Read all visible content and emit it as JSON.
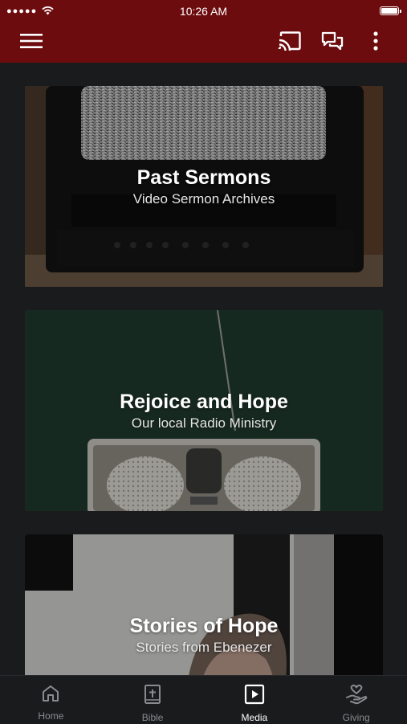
{
  "status_bar": {
    "signal": "●●●●●",
    "time": "10:26 AM"
  },
  "app_bar": {
    "icons": [
      "menu-icon",
      "cast-icon",
      "chat-icon",
      "more-vert-icon"
    ],
    "color": "#6d0c0e"
  },
  "cards": [
    {
      "title": "Past Sermons",
      "subtitle": "Video Sermon Archives"
    },
    {
      "title": "Rejoice and Hope",
      "subtitle": "Our local Radio Ministry"
    },
    {
      "title": "Stories of Hope",
      "subtitle": "Stories from Ebenezer"
    }
  ],
  "tabs": [
    {
      "label": "Home",
      "icon": "home-icon",
      "active": false
    },
    {
      "label": "Bible",
      "icon": "bible-icon",
      "active": false
    },
    {
      "label": "Media",
      "icon": "media-icon",
      "active": true
    },
    {
      "label": "Giving",
      "icon": "giving-icon",
      "active": false
    }
  ],
  "colors": {
    "brand": "#6d0c0e",
    "background": "#1a1b1d",
    "tab_inactive": "#8a8b8e",
    "tab_active": "#ffffff"
  }
}
